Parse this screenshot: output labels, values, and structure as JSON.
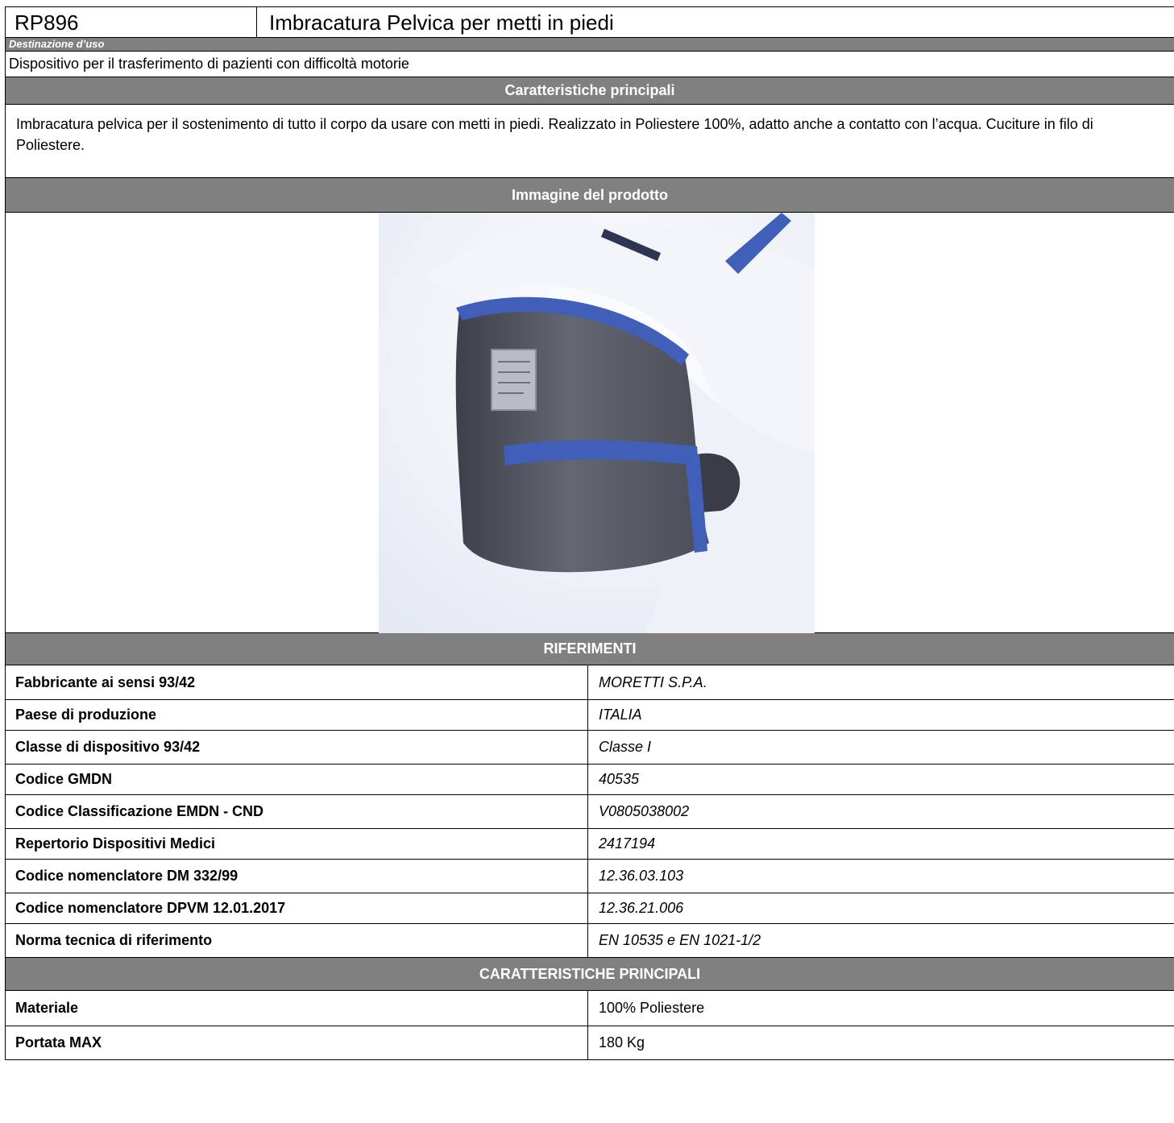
{
  "product": {
    "code": "RP896",
    "name": "Imbracatura Pelvica per metti in piedi"
  },
  "purpose": {
    "header": "Destinazione d’uso",
    "text": "Dispositivo per il trasferimento di pazienti con difficoltà motorie"
  },
  "features": {
    "header": "Caratteristiche principali",
    "description": "Imbracatura pelvica per il sostenimento di tutto il corpo da usare con metti in piedi. Realizzato in Poliestere 100%, adatto anche a contatto con l’acqua. Cuciture in filo di Poliestere."
  },
  "image_section": {
    "header": "Immagine del prodotto"
  },
  "references": {
    "header": "RIFERIMENTI",
    "rows": [
      {
        "label": "Fabbricante ai sensi 93/42",
        "value": "MORETTI S.P.A."
      },
      {
        "label": "Paese di produzione",
        "value": "ITALIA"
      },
      {
        "label": "Classe di dispositivo 93/42",
        "value": "Classe I"
      },
      {
        "label": "Codice GMDN",
        "value": "40535"
      },
      {
        "label": "Codice Classificazione EMDN - CND",
        "value": "V0805038002"
      },
      {
        "label": "Repertorio Dispositivi Medici",
        "value": "2417194"
      },
      {
        "label": "Codice nomenclatore DM 332/99",
        "value": "12.36.03.103"
      },
      {
        "label": "Codice nomenclatore DPVM 12.01.2017",
        "value": "12.36.21.006"
      },
      {
        "label": "Norma tecnica di riferimento",
        "value": "EN 10535 e EN 1021-1/2"
      }
    ]
  },
  "main_specs": {
    "header": "CARATTERISTICHE PRINCIPALI",
    "rows": [
      {
        "label": "Materiale",
        "value": "100% Poliestere"
      },
      {
        "label": "Portata MAX",
        "value": "180 Kg"
      }
    ]
  },
  "colors": {
    "header_bg": "#808080",
    "header_text": "#ffffff",
    "sling_body": "#5c5f6b",
    "sling_trim": "#3f5fb8"
  }
}
